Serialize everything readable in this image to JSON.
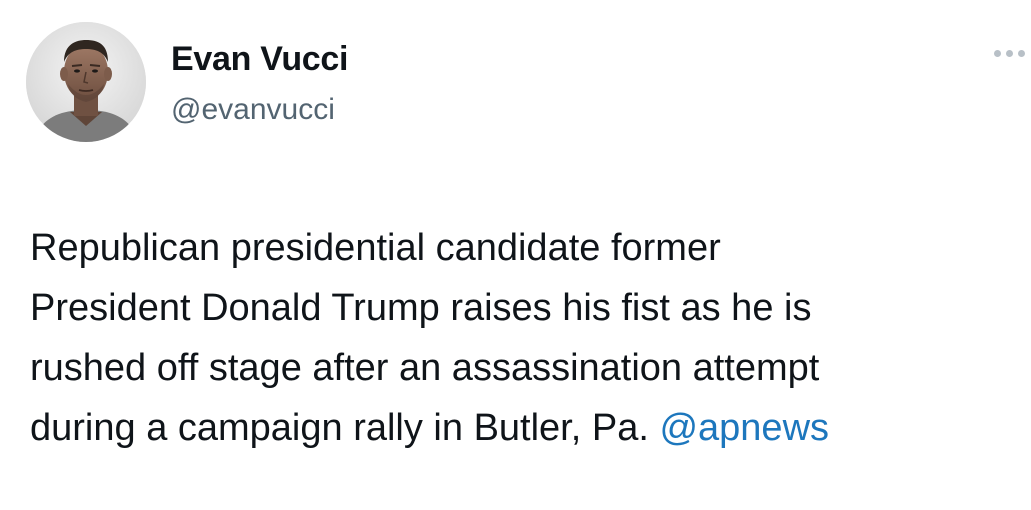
{
  "author": {
    "name": "Evan Vucci",
    "handle": "@evanvucci",
    "avatar_icon": "profile-photo-avatar"
  },
  "more_icon": "ellipsis-icon",
  "tweet": {
    "text_lines": [
      "Republican presidential candidate former",
      "President Donald Trump raises his fist as he is",
      "rushed off stage  after an assassination attempt",
      "during a campaign rally in Butler, Pa. "
    ],
    "mention": "@apnews"
  },
  "colors": {
    "text": "#0f1419",
    "handle": "#536471",
    "link": "#1d77bd",
    "background": "#ffffff"
  }
}
